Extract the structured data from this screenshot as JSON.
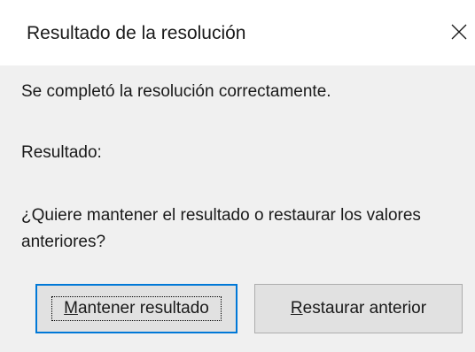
{
  "dialog": {
    "title": "Resultado de la resolución",
    "close_icon": "close-icon"
  },
  "content": {
    "message_success": "Se completó la resolución correctamente.",
    "result_label": "Resultado:",
    "question": "¿Quiere mantener el resultado o restaurar los valores anteriores?"
  },
  "buttons": {
    "keep": {
      "mnemonic": "M",
      "rest": "antener resultado"
    },
    "restore": {
      "mnemonic": "R",
      "rest": "estaurar anterior"
    }
  },
  "colors": {
    "focus_border": "#0078d7",
    "content_bg": "#f0f0f0",
    "button_bg": "#e1e1e1"
  }
}
